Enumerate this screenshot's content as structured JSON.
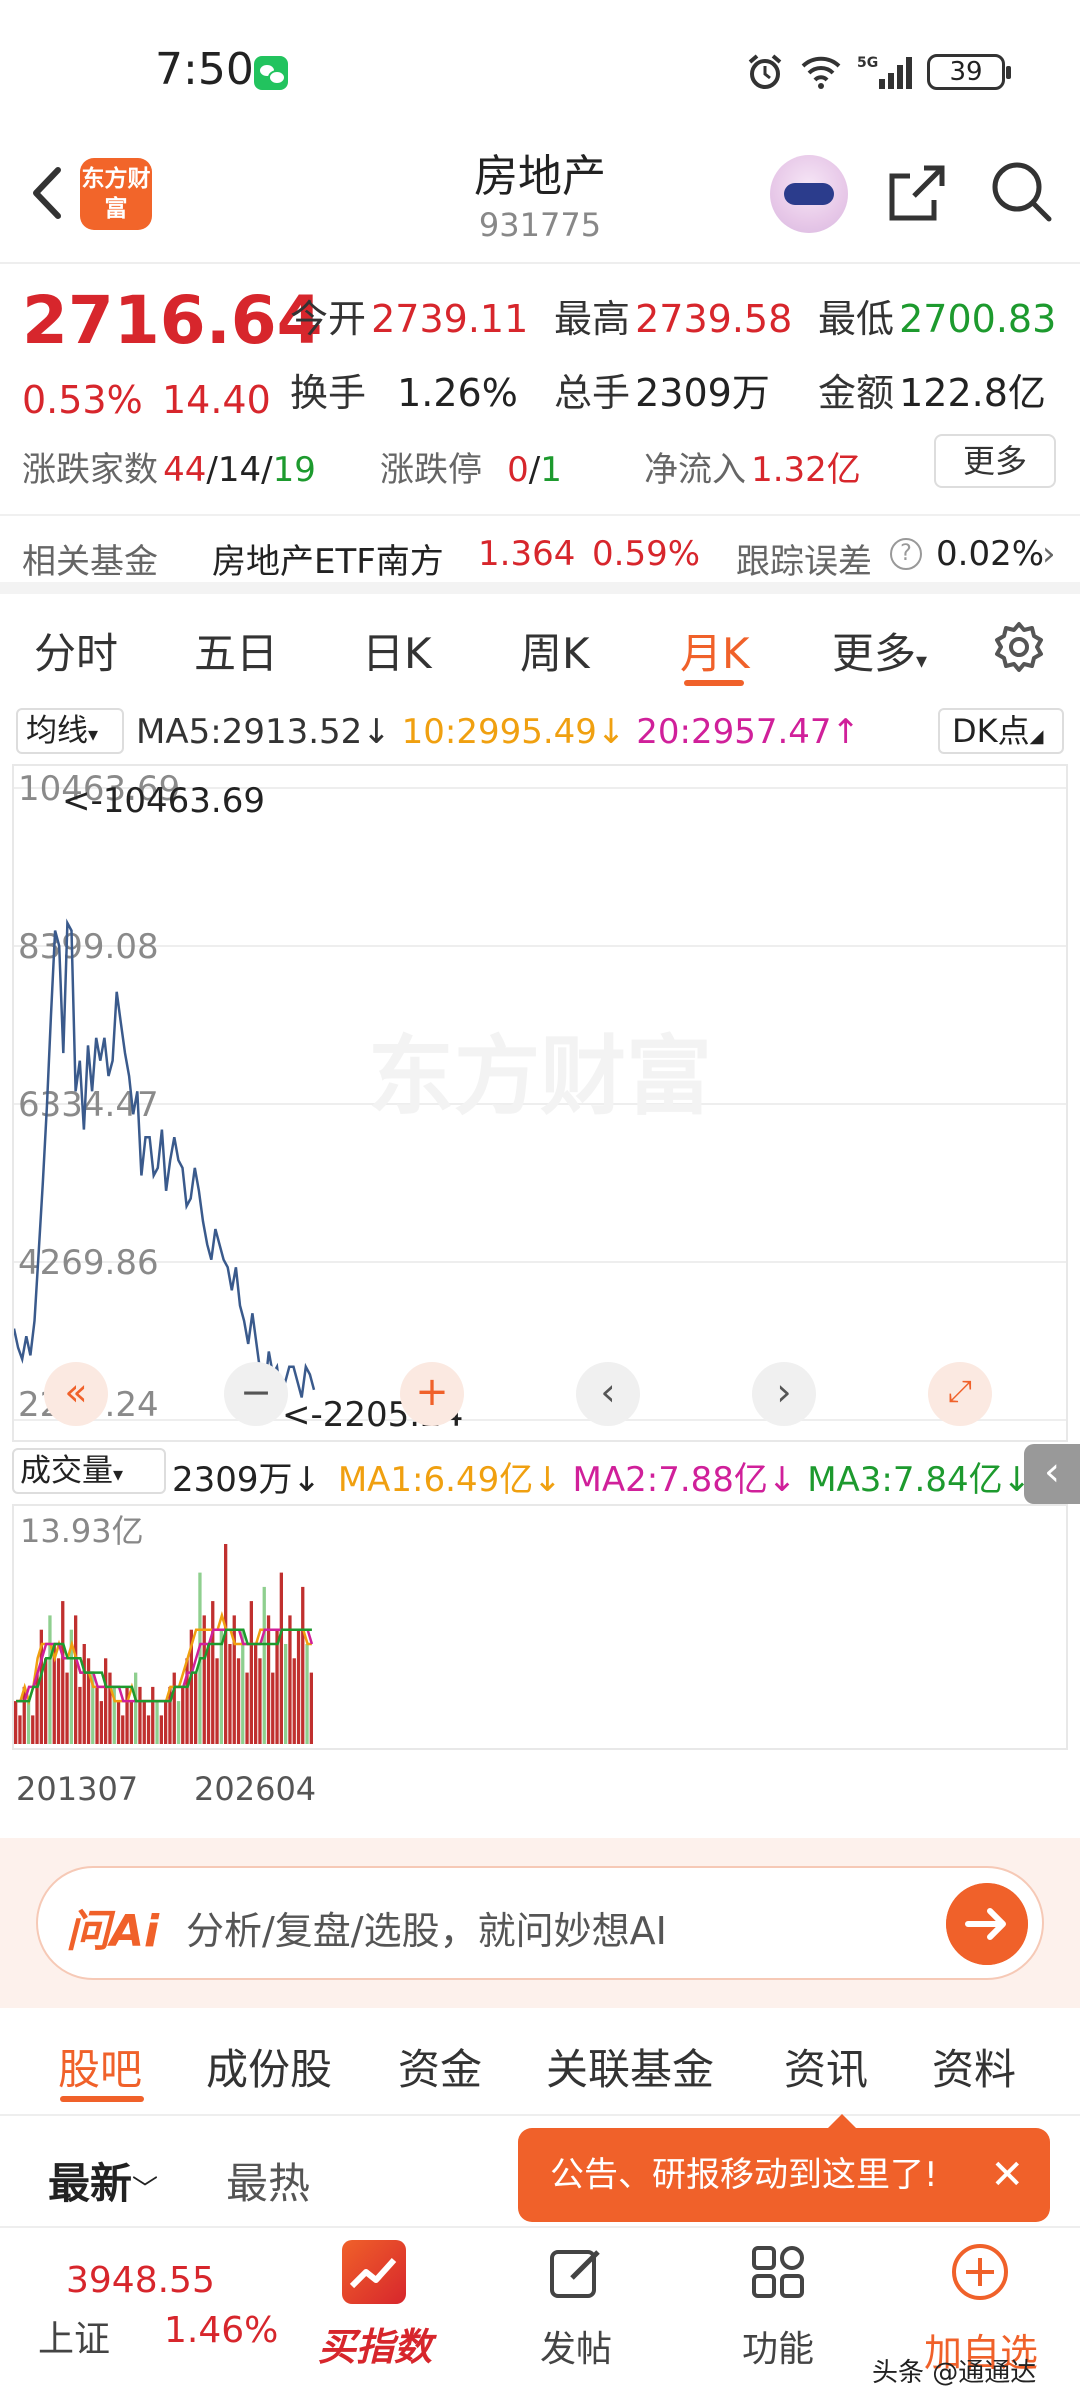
{
  "status_bar": {
    "time": "7:50",
    "battery": "39"
  },
  "header": {
    "title": "房地产",
    "code": "931775",
    "logo_text": "东方财富"
  },
  "quote": {
    "price": "2716.64",
    "change_pct": "0.53%",
    "change_abs": "14.40",
    "open_label": "今开",
    "open": "2739.11",
    "high_label": "最高",
    "high": "2739.58",
    "low_label": "最低",
    "low": "2700.83",
    "turnover_label": "换手",
    "turnover": "1.26%",
    "volume_label": "总手",
    "volume": "2309万",
    "amount_label": "金额",
    "amount": "122.8亿",
    "breadth_label": "涨跌家数",
    "breadth_up": "44",
    "breadth_flat": "14",
    "breadth_down": "19",
    "limit_label": "涨跌停",
    "limit_up": "0",
    "limit_down": "1",
    "netflow_label": "净流入",
    "netflow": "1.32亿",
    "more_label": "更多"
  },
  "fund": {
    "label": "相关基金",
    "name": "房地产ETF南方",
    "price": "1.364",
    "pct": "0.59%",
    "tracking_label": "跟踪误差",
    "tracking": "0.02%"
  },
  "tabs": [
    "分时",
    "五日",
    "日K",
    "周K",
    "月K",
    "更多"
  ],
  "ma": {
    "selector": "均线",
    "ma5": "MA5:2913.52↓",
    "ma10": "10:2995.49↓",
    "ma20": "20:2957.47↑",
    "dk_label": "DK点"
  },
  "chart_data": {
    "type": "line",
    "y_ticks": [
      "10463.69",
      "8399.08",
      "6334.47",
      "4269.86",
      "2205.24"
    ],
    "ylim": [
      2205.24,
      10463.69
    ],
    "max_marker": "<-10463.69",
    "min_marker": "<-2205.24",
    "x_ticks": [
      "201307",
      "202604"
    ],
    "watermark": "东方财富",
    "series": [
      {
        "values": [
          3400,
          3150,
          3000,
          3300,
          3050,
          3500,
          4400,
          5300,
          6300,
          7500,
          8600,
          8400,
          7000,
          8700,
          8600,
          6500,
          6900,
          6000,
          7100,
          6500,
          7200,
          6900,
          7200,
          6700,
          6900,
          7800,
          7400,
          7000,
          6700,
          6200,
          6500,
          5400,
          5900,
          5900,
          5400,
          5500,
          6000,
          5200,
          5600,
          5900,
          5600,
          5500,
          5000,
          5100,
          5500,
          5200,
          4800,
          4500,
          4300,
          4700,
          4500,
          4300,
          4200,
          3900,
          4200,
          3700,
          3500,
          3200,
          3600,
          3200,
          2800,
          2600,
          3100,
          2800,
          2900,
          2500,
          2700,
          2900,
          2900,
          2700,
          2500,
          2900,
          2800,
          2600
        ]
      }
    ]
  },
  "volume": {
    "selector": "成交量",
    "value": "2309万↓",
    "ma1": "MA1:6.49亿↓",
    "ma2": "MA2:7.88亿↓",
    "ma3": "MA3:7.84亿↓",
    "max_label": "13.93亿",
    "bars": [
      3,
      2,
      4,
      3,
      2,
      5,
      8,
      6,
      9,
      7,
      6,
      10,
      5,
      8,
      9,
      4,
      7,
      6,
      5,
      4,
      3,
      6,
      5,
      4,
      3,
      2,
      4,
      3,
      5,
      4,
      3,
      2,
      4,
      3,
      2,
      3,
      4,
      5,
      3,
      4,
      6,
      8,
      5,
      12,
      9,
      7,
      10,
      6,
      8,
      14,
      7,
      9,
      6,
      8,
      5,
      10,
      7,
      6,
      11,
      9,
      5,
      8,
      12,
      7,
      9,
      6,
      8,
      11,
      7,
      5
    ],
    "ma1_line": [
      3,
      3,
      4,
      3,
      4,
      6,
      7,
      7,
      7,
      6,
      7,
      6,
      6,
      7,
      6,
      5,
      5,
      5,
      4,
      4,
      4,
      4,
      4,
      3,
      3,
      3,
      3,
      4,
      3,
      3,
      3,
      3,
      3,
      3,
      3,
      3,
      4,
      4,
      4,
      5,
      6,
      7,
      8,
      8,
      8,
      8,
      8,
      8,
      9,
      8,
      8,
      7,
      7,
      7,
      7,
      7,
      7,
      8,
      8,
      8,
      8,
      8,
      8,
      8,
      8,
      8,
      8,
      8,
      7,
      7
    ],
    "ma2_line": [
      3,
      3,
      3,
      4,
      4,
      5,
      6,
      7,
      7,
      7,
      7,
      6,
      6,
      6,
      6,
      5,
      5,
      5,
      5,
      4,
      4,
      4,
      4,
      4,
      4,
      3,
      3,
      3,
      3,
      3,
      3,
      3,
      3,
      3,
      3,
      3,
      3,
      4,
      4,
      4,
      5,
      5,
      6,
      7,
      7,
      7,
      8,
      8,
      8,
      8,
      8,
      8,
      8,
      7,
      7,
      7,
      7,
      7,
      8,
      8,
      8,
      8,
      8,
      8,
      8,
      8,
      8,
      8,
      8,
      7
    ],
    "ma3_line": [
      3,
      3,
      3,
      3,
      4,
      4,
      5,
      6,
      6,
      7,
      7,
      7,
      6,
      6,
      6,
      6,
      5,
      5,
      5,
      5,
      5,
      4,
      4,
      4,
      4,
      4,
      4,
      4,
      3,
      3,
      3,
      3,
      3,
      3,
      3,
      3,
      3,
      4,
      4,
      4,
      4,
      5,
      5,
      6,
      6,
      7,
      7,
      7,
      7,
      8,
      8,
      8,
      8,
      8,
      7,
      7,
      7,
      7,
      7,
      7,
      7,
      7,
      8,
      8,
      8,
      8,
      8,
      8,
      8,
      8
    ]
  },
  "ai": {
    "logo": "问Ai",
    "placeholder": "分析/复盘/选股，就问妙想AI"
  },
  "subtabs": [
    "股吧",
    "成份股",
    "资金",
    "关联基金",
    "资讯",
    "资料"
  ],
  "sort": {
    "new": "最新",
    "hot": "最热"
  },
  "tooltip": "公告、研报移动到这里了!",
  "bottom_nav": {
    "index_value": "3948.55",
    "index_name": "上证",
    "index_pct": "1.46%",
    "buy_index": "买指数",
    "post": "发帖",
    "function": "功能",
    "add_watch": "加自选"
  },
  "watermark_corner": "头条 @通通达"
}
